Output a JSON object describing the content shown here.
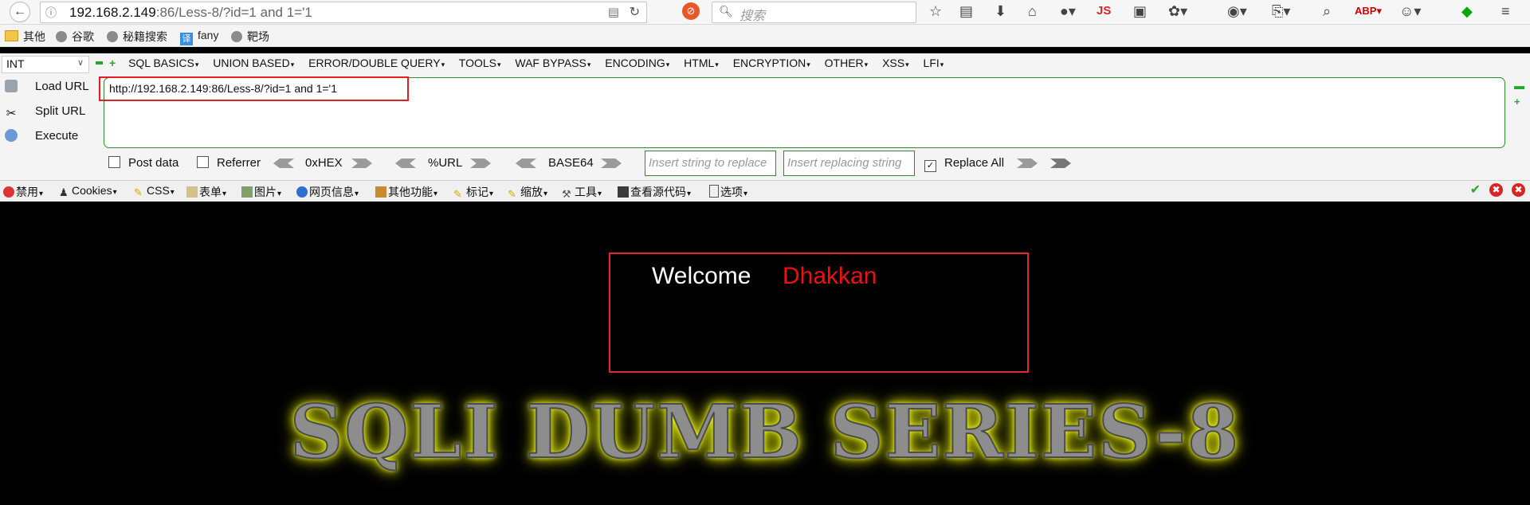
{
  "navbar": {
    "url_host": "192.168.2.149",
    "url_rest": ":86/Less-8/?id=1 and 1='1",
    "search_placeholder": "搜索"
  },
  "bookmarks": [
    "其他",
    "谷歌",
    "秘籍搜索",
    "fany",
    "靶场"
  ],
  "hackbar": {
    "select_value": "INT",
    "menus": [
      "SQL BASICS",
      "UNION BASED",
      "ERROR/DOUBLE QUERY",
      "TOOLS",
      "WAF BYPASS",
      "ENCODING",
      "HTML",
      "ENCRYPTION",
      "OTHER",
      "XSS",
      "LFI"
    ],
    "load_url": "Load URL",
    "split_url": "Split URL",
    "execute": "Execute",
    "url_value": "http://192.168.2.149:86/Less-8/?id=1 and 1='1",
    "post_data": "Post data",
    "referrer": "Referrer",
    "hex": "0xHEX",
    "url_enc": "%URL",
    "base64": "BASE64",
    "replace_placeholder": "Insert string to replace",
    "replacing_placeholder": "Insert replacing string",
    "replace_all": "Replace All"
  },
  "webdev": [
    "禁用",
    "Cookies",
    "CSS",
    "表单",
    "图片",
    "网页信息",
    "其他功能",
    "标记",
    "缩放",
    "工具",
    "查看源代码",
    "选项"
  ],
  "page": {
    "welcome": "Welcome",
    "name": "Dhakkan",
    "title": "SQLI DUMB SERIES-8"
  },
  "colors": {
    "accent_green": "#2e8b2e",
    "highlight_red": "#e02020",
    "name_red": "#ee1111",
    "glow_yellow": "#e8f000"
  }
}
